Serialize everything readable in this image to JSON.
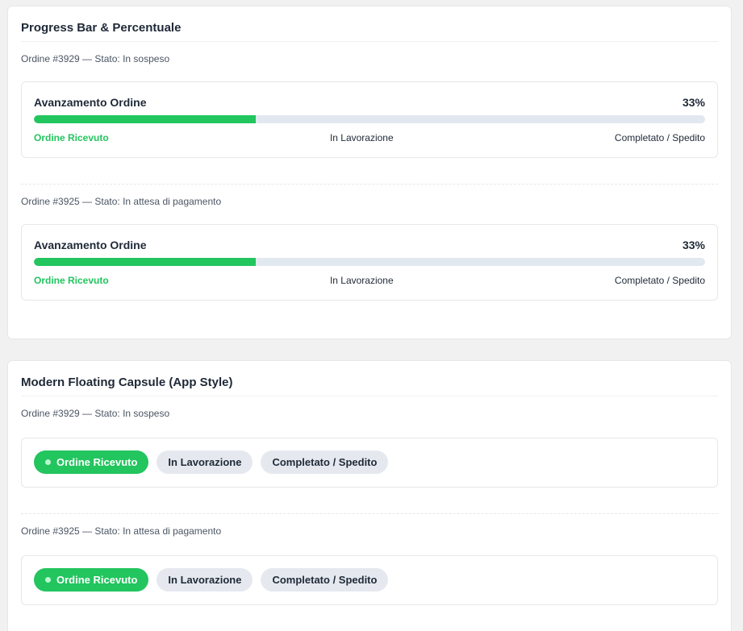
{
  "colors": {
    "accent": "#22c55e",
    "track": "#e2e8f0",
    "pill": "#e5e9ef"
  },
  "progress_section": {
    "title": "Progress Bar & Percentuale",
    "orders": [
      {
        "meta": "Ordine #3929 — Stato: In sospeso",
        "card_title": "Avanzamento Ordine",
        "percent_label": "33%",
        "progress": 0.33,
        "steps": [
          "Ordine Ricevuto",
          "In Lavorazione",
          "Completato / Spedito"
        ]
      },
      {
        "meta": "Ordine #3925 — Stato: In attesa di pagamento",
        "card_title": "Avanzamento Ordine",
        "percent_label": "33%",
        "progress": 0.33,
        "steps": [
          "Ordine Ricevuto",
          "In Lavorazione",
          "Completato / Spedito"
        ]
      }
    ]
  },
  "capsule_section": {
    "title": "Modern Floating Capsule (App Style)",
    "orders": [
      {
        "meta": "Ordine #3929 — Stato: In sospeso",
        "steps": [
          "Ordine Ricevuto",
          "In Lavorazione",
          "Completato / Spedito"
        ]
      },
      {
        "meta": "Ordine #3925 — Stato: In attesa di pagamento",
        "steps": [
          "Ordine Ricevuto",
          "In Lavorazione",
          "Completato / Spedito"
        ]
      }
    ]
  }
}
